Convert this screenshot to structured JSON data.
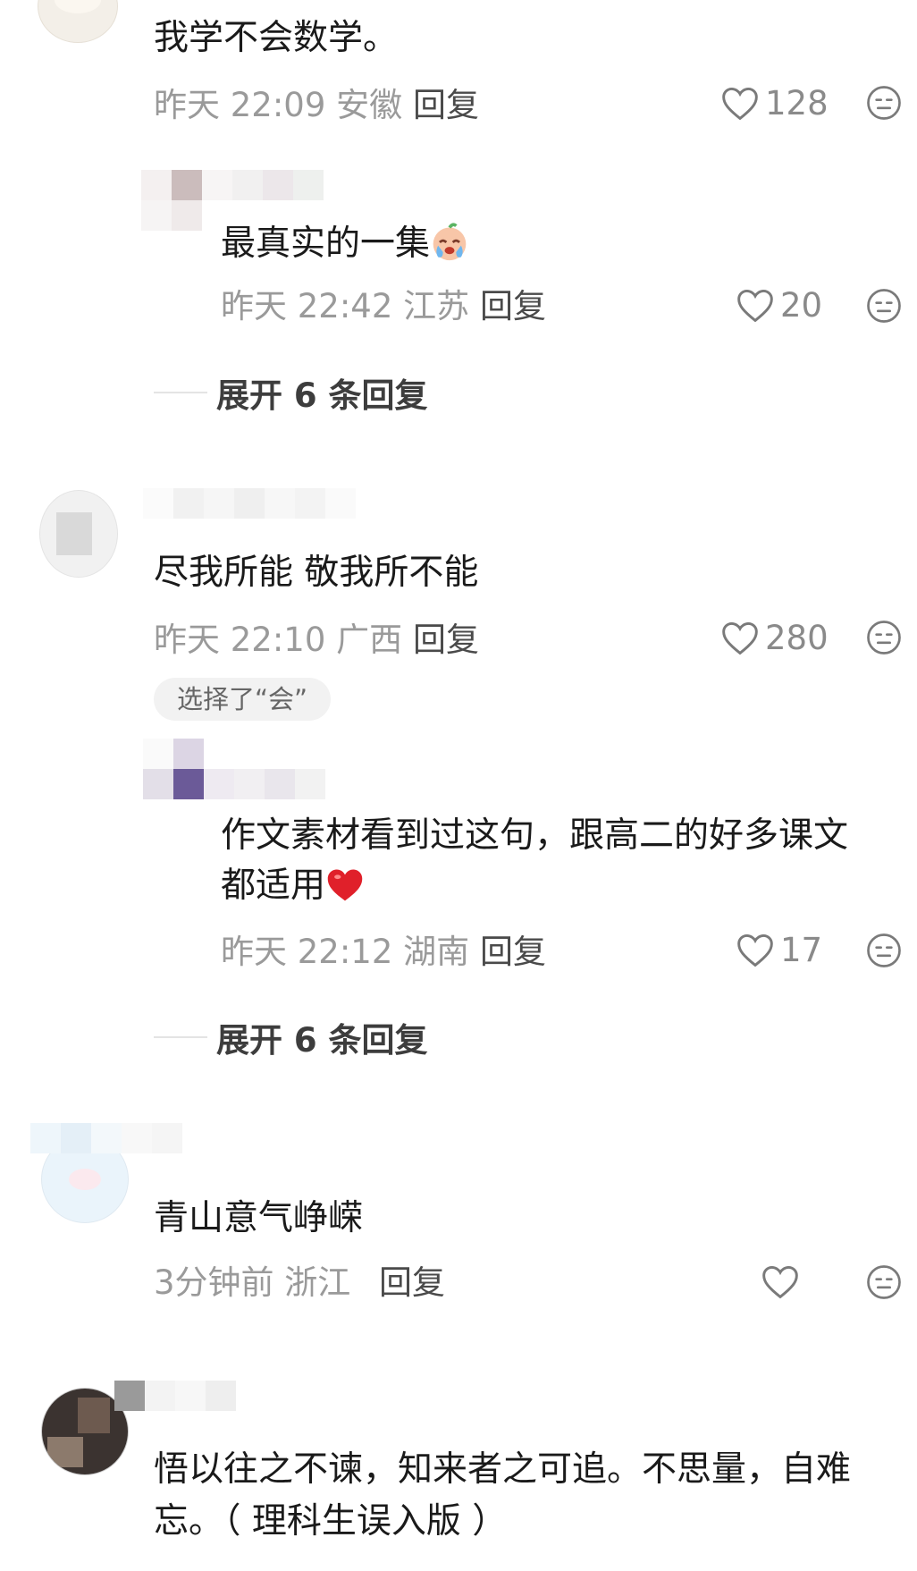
{
  "comments": [
    {
      "text": "我学不会数学。",
      "time": "昨天 22:09 安徽",
      "reply": "回复",
      "likes": "128",
      "replies": [
        {
          "text": "最真实的一集",
          "emoji": "crying-face-emoji",
          "time": "昨天 22:42 江苏",
          "reply": "回复",
          "likes": "20"
        }
      ],
      "expand": "展开 6 条回复"
    },
    {
      "text": "尽我所能 敬我所不能",
      "time": "昨天 22:10 广西",
      "reply": "回复",
      "likes": "280",
      "tag": "选择了“会”",
      "replies": [
        {
          "text_line1": "作文素材看到过这句，跟高二的好多课文",
          "text_line2": "都适用",
          "emoji": "red-heart-emoji",
          "time": "昨天 22:12 湖南",
          "reply": "回复",
          "likes": "17"
        }
      ],
      "expand": "展开 6 条回复"
    },
    {
      "text": "青山意气峥嵘",
      "time": "3分钟前 浙江",
      "reply": "回复",
      "likes": ""
    },
    {
      "text_line1": "悟以往之不谏，知来者之可追。不思量，自难",
      "text_line2": "忘。（ 理科生误入版 ）"
    }
  ],
  "icons": {
    "like": "heart-outline-icon",
    "dislike": "meh-face-icon"
  },
  "colors": {
    "meta": "#9a9a9a",
    "reply": "#4a4a4a",
    "heart": "#e0202a"
  }
}
